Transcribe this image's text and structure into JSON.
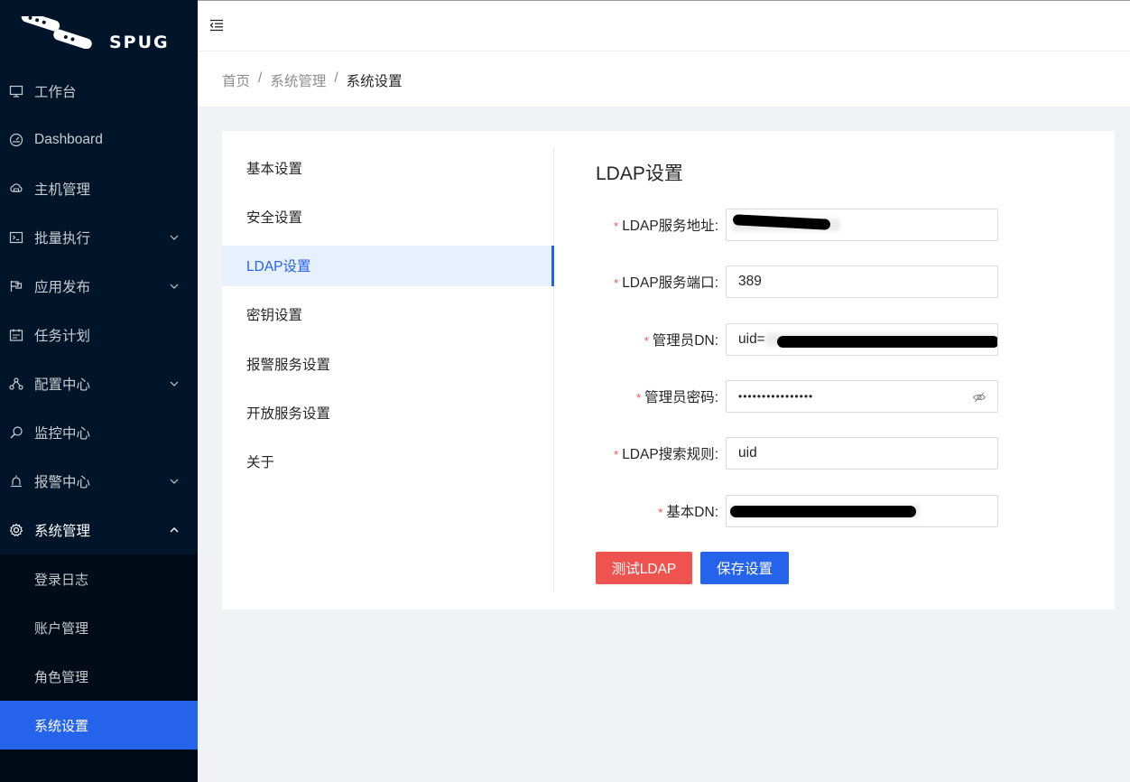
{
  "app": {
    "logo_text": "SPUG"
  },
  "sidebar": {
    "items": [
      {
        "label": "工作台",
        "icon": "desktop-icon"
      },
      {
        "label": "Dashboard",
        "icon": "dashboard-icon"
      },
      {
        "label": "主机管理",
        "icon": "cloud-server-icon"
      },
      {
        "label": "批量执行",
        "icon": "code-icon",
        "expandable": true
      },
      {
        "label": "应用发布",
        "icon": "flag-icon",
        "expandable": true
      },
      {
        "label": "任务计划",
        "icon": "schedule-icon"
      },
      {
        "label": "配置中心",
        "icon": "deployment-unit-icon",
        "expandable": true
      },
      {
        "label": "监控中心",
        "icon": "monitor-icon"
      },
      {
        "label": "报警中心",
        "icon": "alert-icon",
        "expandable": true
      },
      {
        "label": "系统管理",
        "icon": "setting-icon",
        "expanded": true
      }
    ],
    "submenu": [
      {
        "label": "登录日志"
      },
      {
        "label": "账户管理"
      },
      {
        "label": "角色管理"
      },
      {
        "label": "系统设置",
        "active": true
      }
    ]
  },
  "breadcrumb": [
    "首页",
    "系统管理",
    "系统设置"
  ],
  "settings_tabs": [
    "基本设置",
    "安全设置",
    "LDAP设置",
    "密钥设置",
    "报警服务设置",
    "开放服务设置",
    "关于"
  ],
  "active_tab": "LDAP设置",
  "panel": {
    "title": "LDAP设置",
    "fields": {
      "server": {
        "label": "LDAP服务地址",
        "value": ""
      },
      "port": {
        "label": "LDAP服务端口",
        "value": "389"
      },
      "admin_dn": {
        "label": "管理员DN",
        "value": "uid="
      },
      "admin_password": {
        "label": "管理员密码",
        "value": "••••••••••••••••"
      },
      "search_rule": {
        "label": "LDAP搜索规则",
        "value": "uid"
      },
      "base_dn": {
        "label": "基本DN",
        "value": ""
      }
    },
    "buttons": {
      "test": "测试LDAP",
      "save": "保存设置"
    }
  },
  "colors": {
    "sidebar_bg": "#001529",
    "primary": "#2563eb",
    "danger": "#ef5350",
    "required": "#ff4d4f"
  }
}
